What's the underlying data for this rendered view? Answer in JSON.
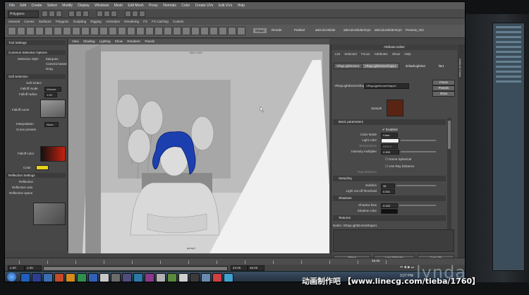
{
  "menubar": {
    "items": [
      "File",
      "Edit",
      "Create",
      "Select",
      "Modify",
      "Display",
      "Windows",
      "Mesh",
      "Edit Mesh",
      "Proxy",
      "Normals",
      "Color",
      "Create UVs",
      "Edit UVs",
      "Help"
    ]
  },
  "status": {
    "mode": "Polygons"
  },
  "shelf": {
    "tabs": [
      "General",
      "Curves",
      "Surfaces",
      "Polygons",
      "Sculpting",
      "Rigging",
      "Animation",
      "Rendering",
      "FX",
      "FX Caching",
      "Custom"
    ],
    "text_buttons": [
      "Shape",
      "Render",
      "Partikel",
      "attrColorSlider",
      "attrColorSliderGrp1",
      "attrColorSliderGrp2",
      "Preview_Visi"
    ]
  },
  "left_panel": {
    "head1": "Tool Settings",
    "head2": "Common Selection Options",
    "head3": "Soft Selection",
    "head4": "Reflection Settings",
    "rows": [
      "Selection Style",
      "Marquee",
      "Camera based",
      "Drag",
      "Soft Select",
      "Falloff mode",
      "Falloff radius",
      "Falloff curve",
      "Interpolation",
      "Curve presets",
      "Falloff color",
      "Color",
      "Reflection",
      "Reflection axis",
      "Reflection space"
    ],
    "values": [
      "Volume",
      "1.00",
      "None"
    ],
    "colors": {
      "gradient_red": "#c8210f",
      "yellow": "#e9d21a"
    }
  },
  "viewport": {
    "menu": [
      "View",
      "Shading",
      "Lighting",
      "Show",
      "Renderer",
      "Panels"
    ],
    "resolution_label": "960 x 540",
    "camera_label": "persp1",
    "colors": {
      "wall": "#bcbcbc",
      "floor": "#d6d6d6",
      "light": "#efefef",
      "hair": "#1c3fb0"
    }
  },
  "attribute_editor": {
    "title": "Attribute Editor",
    "tabs": [
      "List",
      "Selected",
      "Focus",
      "Attributes",
      "Show",
      "Help"
    ],
    "chips": [
      "VRayLightDome1",
      "VRayLightDomeShape1",
      "defaultLightSet",
      "lite1"
    ],
    "shape_label": "VRayLightDomeShape",
    "shape_value": "VRayLightDomeShape1",
    "focus_button": "Focus",
    "presets_button": "Presets",
    "show_button": "Show",
    "sample_label": "Sample",
    "sample_color": "#5a2412",
    "sections": {
      "basic": "Basic parameters",
      "sampling": "Sampling",
      "shadows": "Shadows",
      "textures": "Textures"
    },
    "basic_rows": [
      {
        "label": "",
        "value": "Enabled"
      },
      {
        "label": "Color Mode",
        "value": "Color"
      },
      {
        "label": "Light color",
        "value": ""
      },
      {
        "label": "Temperature",
        "value": "6500.0"
      },
      {
        "label": "Intensity multiplier",
        "value": "2.200"
      },
      {
        "label": "",
        "value": "Dome Spherical"
      },
      {
        "label": "",
        "value": "Use Ray Distance"
      },
      {
        "label": "Ray Distance",
        "value": ""
      }
    ],
    "sampling_rows": [
      {
        "label": "Subdivs",
        "value": "46"
      },
      {
        "label": "Light cut-off threshold",
        "value": "0.001"
      }
    ],
    "shadow_rows": [
      {
        "label": "Shadow bias",
        "value": "0.020"
      },
      {
        "label": "Shadow color",
        "value": ""
      }
    ],
    "notes_label": "Notes: VRayLightDomeShape1",
    "bottom_buttons": [
      "Select",
      "Load Attributes",
      "Copy Tab"
    ]
  },
  "timeline": {
    "range_values": [
      "1.00",
      "1.00",
      "24.00",
      "48.00"
    ],
    "end_value": "48.00"
  },
  "taskbar": {
    "time": "3:27 PM"
  },
  "watermark": {
    "brand": "lynda",
    "subtitle": "动画制作吧 【www.linecg.com/tieba/1760】"
  }
}
